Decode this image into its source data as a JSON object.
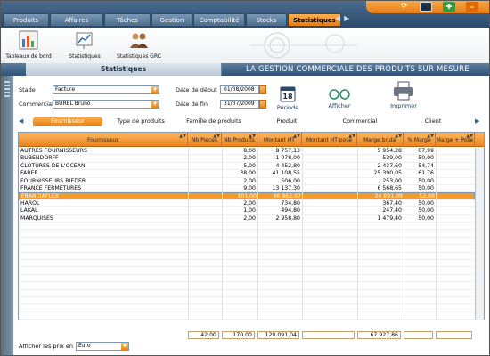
{
  "nav": {
    "tabs": [
      "Produits",
      "Affaires",
      "Tâches",
      "Gestion",
      "Comptabilité",
      "Stocks",
      "Statistiques"
    ],
    "active_tab": "Statistiques"
  },
  "toolbar": {
    "buttons": [
      "Tableaux de bord",
      "Statistiques",
      "Statistiques GRC"
    ]
  },
  "header": {
    "title": "Statistiques",
    "slogan": "LA GESTION COMMERCIALE DES PRODUITS SUR MESURE"
  },
  "filters": {
    "stade_label": "Stade",
    "stade_value": "Facture",
    "commercial_label": "Commercial",
    "commercial_value": "BUREL Bruno",
    "date_debut_label": "Date de début",
    "date_debut_value": "01/08/2008",
    "date_fin_label": "Date de fin",
    "date_fin_value": "31/07/2009",
    "periode_label": "Période",
    "calendar_number": "18",
    "afficher_label": "Afficher",
    "imprimer_label": "Imprimer"
  },
  "category_tabs": [
    "Fournisseur",
    "Type de produits",
    "Famille de produits",
    "Produit",
    "Commercial",
    "Client"
  ],
  "table": {
    "columns": [
      "Fournisseur",
      "Nb Pieces",
      "Nb Produits",
      "Montant HT",
      "Montant HT posé",
      "Marge brute",
      "% Marge",
      "Marge + Pose"
    ],
    "rows": [
      [
        "AUTRES FOURNISSEURS",
        "",
        "8,00",
        "8 757,13",
        "",
        "5 954,28",
        "67,99",
        ""
      ],
      [
        "BUBENDORFF",
        "",
        "2,00",
        "1 078,00",
        "",
        "539,00",
        "50,00",
        ""
      ],
      [
        "CLOTURES DE L'OCEAN",
        "",
        "5,00",
        "4 452,80",
        "",
        "2 437,60",
        "54,74",
        ""
      ],
      [
        "FABER",
        "",
        "38,00",
        "41 108,55",
        "",
        "25 390,05",
        "61,76",
        ""
      ],
      [
        "FOURNISSEURS RIEDER",
        "",
        "2,00",
        "506,00",
        "",
        "253,00",
        "50,00",
        ""
      ],
      [
        "FRANCE FERMETURES",
        "",
        "9,00",
        "13 137,30",
        "",
        "6 568,65",
        "50,00",
        ""
      ],
      [
        "FRANCIAFLEX",
        "",
        "101,00",
        "46 962,07",
        "",
        "24 691,09",
        "52,69",
        ""
      ],
      [
        "HAROL",
        "",
        "2,00",
        "734,80",
        "",
        "367,40",
        "50,00",
        ""
      ],
      [
        "LAKAL",
        "",
        "1,00",
        "494,80",
        "",
        "247,40",
        "50,00",
        ""
      ],
      [
        "MARQUISES",
        "",
        "2,00",
        "2 958,80",
        "",
        "1 479,40",
        "50,00",
        ""
      ]
    ],
    "selected_row": 6
  },
  "totals": [
    "42,00",
    "170,00",
    "120 091,04",
    "",
    "67 927,86",
    "",
    ""
  ],
  "footer": {
    "label": "Afficher les prix en",
    "currency": "Euro"
  }
}
